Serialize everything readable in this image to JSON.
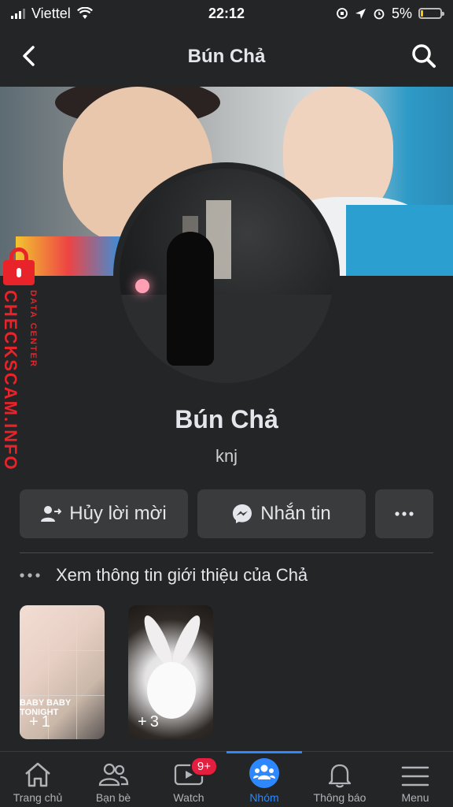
{
  "status_bar": {
    "carrier": "Viettel",
    "time": "22:12",
    "battery": "5%"
  },
  "nav": {
    "title": "Bún Chả"
  },
  "watermark": {
    "main": "CHECKSCAM.INFO",
    "sub": "DATA CENTER"
  },
  "profile": {
    "name": "Bún Chả",
    "nickname": "knj"
  },
  "actions": {
    "cancel_label": "Hủy lời mời",
    "message_label": "Nhắn tin"
  },
  "intro": {
    "label": "Xem thông tin giới thiệu của Chả"
  },
  "highlights": [
    {
      "count": "1",
      "text": "BABY BABY TONIGHT"
    },
    {
      "count": "3"
    }
  ],
  "tabs": [
    {
      "label": "Trang chủ"
    },
    {
      "label": "Bạn bè"
    },
    {
      "label": "Watch",
      "badge": "9+"
    },
    {
      "label": "Nhóm",
      "active": true
    },
    {
      "label": "Thông báo"
    },
    {
      "label": "Menu"
    }
  ],
  "colors": {
    "background": "#242526",
    "button": "#3a3b3c",
    "accent": "#2d88ff",
    "badge": "#e41e3f",
    "watermark": "#e8232a"
  }
}
